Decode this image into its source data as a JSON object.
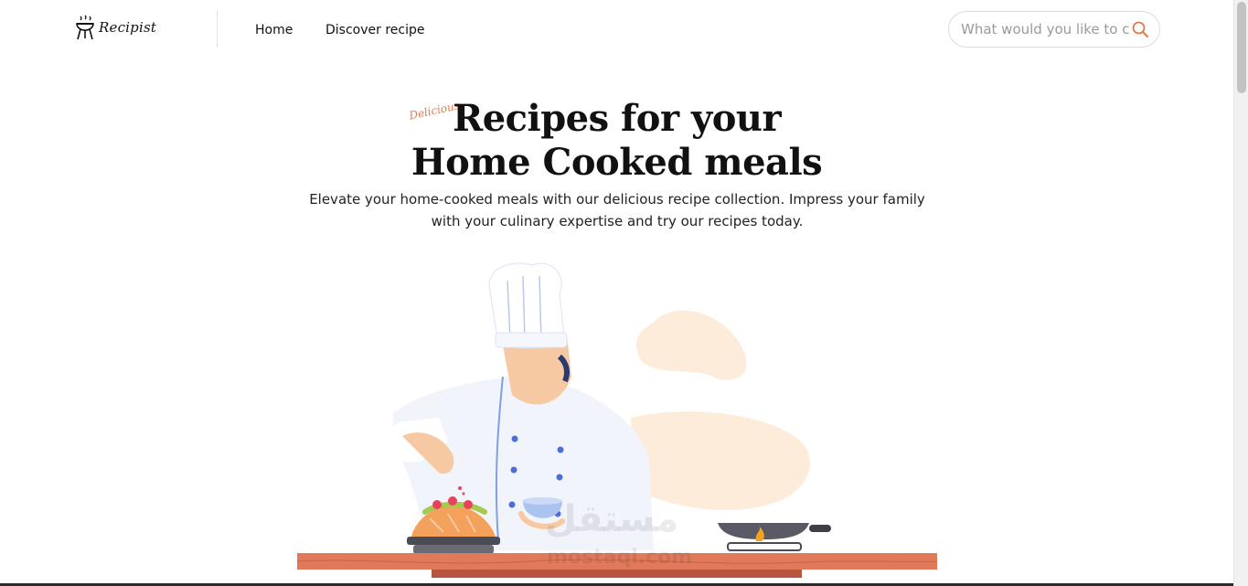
{
  "brand": {
    "name": "Recipist",
    "icon": "grill-icon"
  },
  "nav": {
    "items": [
      {
        "label": "Home"
      },
      {
        "label": "Discover recipe"
      }
    ]
  },
  "search": {
    "placeholder": "What would you like to cook?",
    "icon": "search-icon"
  },
  "hero": {
    "tag": "Delicious",
    "title_line1": "Recipes for your",
    "title_line2": "Home Cooked meals",
    "subtitle": "Elevate your home-cooked meals with our delicious recipe collection. Impress your family with your culinary expertise and try our recipes today."
  },
  "watermark": {
    "arabic": "مستقل",
    "latin": "mostaql.com"
  },
  "colors": {
    "accent": "#e07a4f",
    "counter": "#e07a5b",
    "text": "#111111"
  }
}
